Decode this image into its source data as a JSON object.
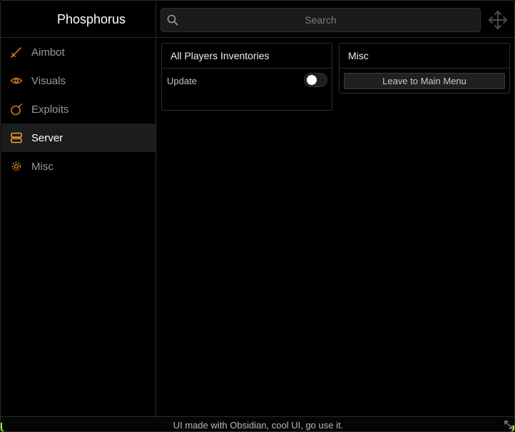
{
  "app": {
    "title": "Phosphorus",
    "accent_color": "#f0a030"
  },
  "search": {
    "placeholder": "Search",
    "value": ""
  },
  "sidebar": {
    "items": [
      {
        "label": "Aimbot",
        "icon": "sword-icon",
        "active": false
      },
      {
        "label": "Visuals",
        "icon": "eye-icon",
        "active": false
      },
      {
        "label": "Exploits",
        "icon": "bomb-icon",
        "active": false
      },
      {
        "label": "Server",
        "icon": "server-icon",
        "active": true
      },
      {
        "label": "Misc",
        "icon": "gear-icon",
        "active": false
      }
    ]
  },
  "panels": {
    "players": {
      "title": "All Players Inventories",
      "update_label": "Update",
      "update_enabled": false
    },
    "misc": {
      "title": "Misc",
      "leave_button": "Leave to Main Menu"
    }
  },
  "footer": {
    "text": "UI made with Obsidian, cool UI, go use it."
  }
}
